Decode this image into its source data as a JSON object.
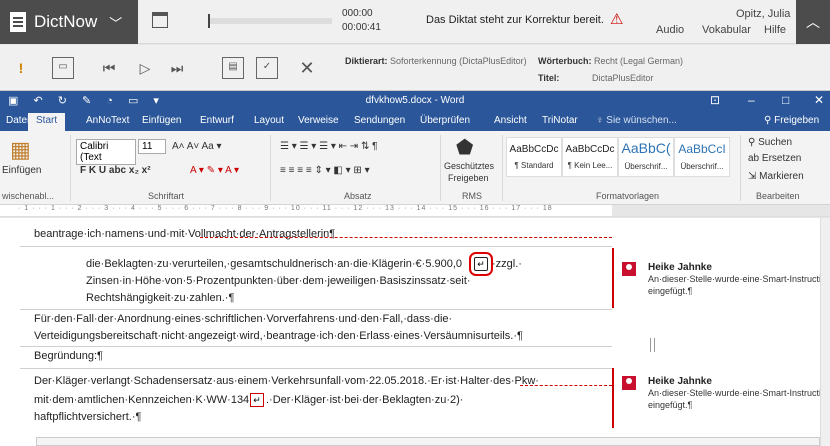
{
  "dictnow": {
    "app_name": "DictNow",
    "time_elapsed": "000:00",
    "time_total": "00:00:41",
    "status": "Das Diktat steht zur Korrektur bereit.",
    "audio_label": "Audio",
    "user": "Opitz, Julia",
    "menu_vokabular": "Vokabular",
    "menu_hilfe": "Hilfe",
    "diktierart_label": "Diktierart:",
    "diktierart_value": "Soforterkennung (DictaPlusEditor)",
    "woerterbuch_label": "Wörterbuch:",
    "woerterbuch_value": "Recht (Legal German)",
    "titel_label": "Titel:",
    "titel_value": "DictaPlusEditor",
    "progress": 0.0
  },
  "word": {
    "title": "dfvkhow5.docx  -  Word",
    "tabs": [
      "Datei",
      "Start",
      "AnNoText",
      "Einfügen",
      "Entwurf",
      "Layout",
      "Verweise",
      "Sendungen",
      "Überprüfen",
      "Ansicht",
      "TriNotar"
    ],
    "search": "Sie wünschen...",
    "share": "Freigeben",
    "ribbon": {
      "paste": "Einfügen",
      "font_name": "Calibri (Text",
      "font_size": "11",
      "clipboard_group": "wischenabl...",
      "font_group": "Schriftart",
      "paragraph_group": "Absatz",
      "rms_group": "RMS",
      "protected": "Geschütztes",
      "share_btn": "Freigeben",
      "styles_group": "Formatvorlagen",
      "edit_group": "Bearbeiten",
      "find": "Suchen",
      "replace": "Ersetzen",
      "select": "Markieren",
      "styles": [
        {
          "sample": "AaBbCcDc",
          "name": "¶ Standard"
        },
        {
          "sample": "AaBbCcDc",
          "name": "¶ Kein Lee..."
        },
        {
          "sample": "AaBbC(",
          "name": "Überschrif..."
        },
        {
          "sample": "AaBbCcI",
          "name": "Überschrif..."
        }
      ]
    },
    "ruler": "· 1 · · · 1 · · · 2 · · · 3 · · · 4 · · · 5 · · · 6 · · · 7 · · · 8 · · · 9 · · · 10 · · · 11 · · · 12 · · · 13 · · · 14 · · · 15 · · · 16 · · · 17 · · · 18"
  },
  "document": {
    "p1": "beantrage·ich·namens·und·mit·Vollmacht·der·Antragstellerin¶",
    "p2a": "die·Beklagten·zu·verurteilen,·gesamtschuldnerisch·an·die·Klägerin·€·5.900,0",
    "p2a_tail": "·zzgl.·",
    "p2b": "Zinsen·in·Höhe·von·5·Prozentpunkten·über·dem·jeweiligen·Basiszinssatz·seit·",
    "p2c": "Rechtshängigkeit·zu·zahlen.·¶",
    "p3a": "Für·den·Fall·der·Anordnung·eines·schriftlichen·Vorverfahrens·und·den·Fall,·dass·die·",
    "p3b": "Verteidigungsbereitschaft·nicht·angezeigt·wird,·beantrage·ich·den·Erlass·eines·Versäumnisurteils.·¶",
    "p4": "Begründung:¶",
    "p5a": "Der·Kläger·verlangt·Schadensersatz·aus·einem·Verkehrsunfall·vom·22.05.2018.·Er·ist·Halter·des·Pkw·",
    "p5b_pre": "mit·dem·amtlichen·Kennzeichen·K·WW·134",
    "p5b_post": ".·Der·Kläger·ist·bei·der·Beklagten·zu·2)·",
    "p5c": "haftpflichtversichert.·¶"
  },
  "comments": [
    {
      "author": "Heike Jahnke",
      "text": "An·dieser·Stelle·wurde·eine·Smart-Instruction",
      "text2": "eingefügt.¶"
    },
    {
      "author": "Heike Jahnke",
      "text": "An·dieser·Stelle·wurde·eine·Smart-Instruction",
      "text2": "eingefügt.¶"
    }
  ]
}
